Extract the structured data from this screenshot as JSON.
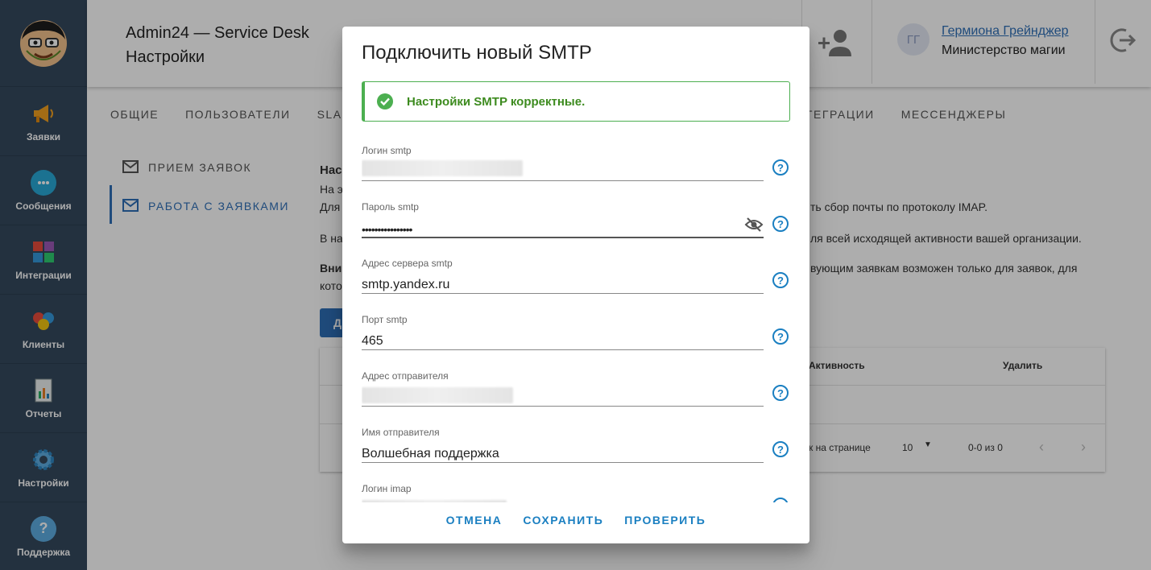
{
  "app": {
    "title": "Admin24 — Service Desk",
    "subtitle": "Настройки"
  },
  "sidebar": {
    "items": [
      {
        "label": "Заявки",
        "icon": "megaphone-icon"
      },
      {
        "label": "Сообщения",
        "icon": "chat-icon"
      },
      {
        "label": "Интеграции",
        "icon": "puzzle-icon"
      },
      {
        "label": "Клиенты",
        "icon": "clients-icon"
      },
      {
        "label": "Отчеты",
        "icon": "report-icon"
      },
      {
        "label": "Настройки",
        "icon": "gear-icon"
      },
      {
        "label": "Поддержка",
        "icon": "help-icon"
      }
    ]
  },
  "user": {
    "initials": "ГГ",
    "name": "Гермиона Грейнджер",
    "org": "Министерство магии"
  },
  "tabs": [
    "ОБЩИЕ",
    "ПОЛЬЗОВАТЕЛИ",
    "SLA",
    "ТЕГРАЦИИ",
    "МЕССЕНДЖЕРЫ"
  ],
  "submenu": [
    "ПРИЕМ ЗАЯВОК",
    "РАБОТА С ЗАЯВКАМИ"
  ],
  "background": {
    "heading": "Нас",
    "line1": "На э",
    "line2": "Для",
    "line2_tail": "ть сбор почты по протоколу IMAP.",
    "line3": "В на",
    "line3_tail": "ля всей исходящей активности вашей организации.",
    "line4": "Вни",
    "line4_tail": "вующим заявкам возможен только для заявок, для",
    "line5": "кото",
    "btn": "Д",
    "table": {
      "col_active": "Активность",
      "col_delete": "Удалить",
      "per_page_label": "к на странице",
      "per_page": "10",
      "range": "0-0 из 0"
    }
  },
  "modal": {
    "title": "Подключить новый SMTP",
    "alert": "Настройки SMTP корректные.",
    "fields": [
      {
        "label": "Логин smtp",
        "value": ""
      },
      {
        "label": "Пароль smtp",
        "value": "••••••••••••••••"
      },
      {
        "label": "Адрес сервера smtp",
        "value": "smtp.yandex.ru"
      },
      {
        "label": "Порт smtp",
        "value": "465"
      },
      {
        "label": "Адрес отправителя",
        "value": ""
      },
      {
        "label": "Имя отправителя",
        "value": "Волшебная поддержка"
      },
      {
        "label": "Логин imap",
        "value": ""
      }
    ],
    "actions": {
      "cancel": "ОТМЕНА",
      "save": "СОХРАНИТЬ",
      "check": "ПРОВЕРИТЬ"
    }
  },
  "colors": {
    "accent": "#1a7fc1",
    "sidebar": "#34495e",
    "success": "#4caf50"
  }
}
